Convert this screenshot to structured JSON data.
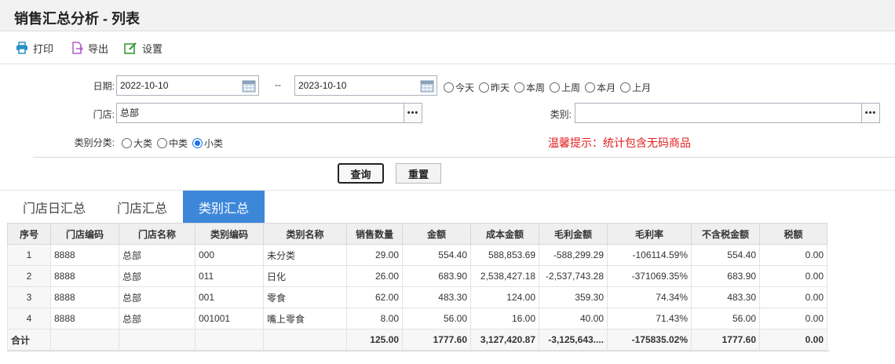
{
  "window": {
    "title": "销售汇总分析 - 列表"
  },
  "toolbar": {
    "print_label": "打印",
    "export_label": "导出",
    "settings_label": "设置"
  },
  "filters": {
    "date_label": "日期:",
    "date_from": "2022-10-10",
    "date_sep": "--",
    "date_to": "2023-10-10",
    "date_shortcuts": [
      "今天",
      "昨天",
      "本周",
      "上周",
      "本月",
      "上月"
    ],
    "store_label": "门店:",
    "store_value": "总部",
    "category_label": "类别:",
    "category_value": "",
    "category_class_label": "类别分类:",
    "category_classes": [
      "大类",
      "中类",
      "小类"
    ],
    "category_class_selected": "小类",
    "tip": "温馨提示：统计包含无码商品",
    "query_label": "查询",
    "reset_label": "重置",
    "more_glyph": "•••"
  },
  "tabs": [
    {
      "label": "门店日汇总",
      "active": false
    },
    {
      "label": "门店汇总",
      "active": false
    },
    {
      "label": "类别汇总",
      "active": true
    }
  ],
  "table": {
    "columns": [
      "序号",
      "门店编码",
      "门店名称",
      "类别编码",
      "类别名称",
      "销售数量",
      "金额",
      "成本金额",
      "毛利金额",
      "毛利率",
      "不含税金额",
      "税额"
    ],
    "rows": [
      [
        "1",
        "8888",
        "总部",
        "000",
        "未分类",
        "29.00",
        "554.40",
        "588,853.69",
        "-588,299.29",
        "-106114.59%",
        "554.40",
        "0.00"
      ],
      [
        "2",
        "8888",
        "总部",
        "011",
        "日化",
        "26.00",
        "683.90",
        "2,538,427.18",
        "-2,537,743.28",
        "-371069.35%",
        "683.90",
        "0.00"
      ],
      [
        "3",
        "8888",
        "总部",
        "001",
        "零食",
        "62.00",
        "483.30",
        "124.00",
        "359.30",
        "74.34%",
        "483.30",
        "0.00"
      ],
      [
        "4",
        "8888",
        "总部",
        "001001",
        "嘴上零食",
        "8.00",
        "56.00",
        "16.00",
        "40.00",
        "71.43%",
        "56.00",
        "0.00"
      ]
    ],
    "total": [
      "合计",
      "",
      "",
      "",
      "",
      "125.00",
      "1777.60",
      "3,127,420.87",
      "-3,125,643....",
      "-175835.02%",
      "1777.60",
      "0.00"
    ]
  },
  "colors": {
    "accent": "#3d87d9",
    "tip": "#e02020"
  },
  "icons": {
    "print": "printer-icon",
    "export": "export-icon",
    "settings": "edit-settings-icon",
    "calendar": "calendar-icon"
  }
}
